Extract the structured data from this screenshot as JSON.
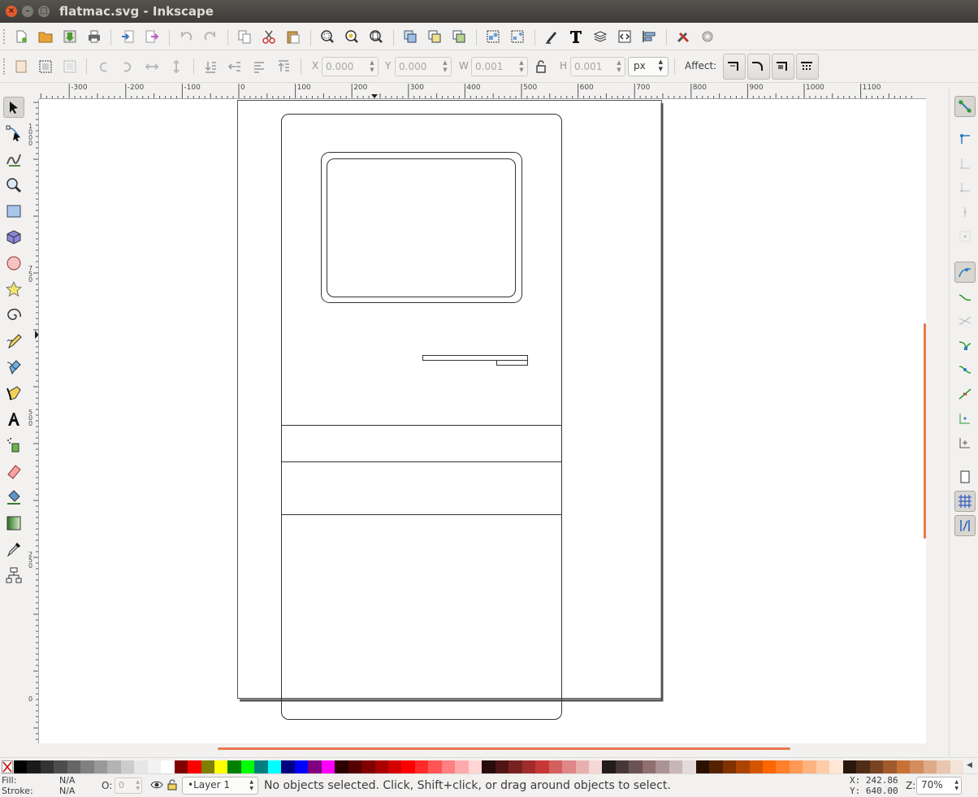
{
  "window": {
    "title": "flatmac.svg - Inkscape",
    "close_glyph": "×",
    "minimize_glyph": "–",
    "maximize_glyph": "□"
  },
  "controls": {
    "x_label": "X",
    "x_value": "0.000",
    "y_label": "Y",
    "y_value": "0.000",
    "w_label": "W",
    "w_value": "0.001",
    "h_label": "H",
    "h_value": "0.001",
    "unit": "px",
    "affect_label": "Affect:"
  },
  "rulers": {
    "horizontal": [
      "-300",
      "-200",
      "-100",
      "0",
      "100",
      "200",
      "300",
      "400",
      "500",
      "600",
      "700",
      "800",
      "900",
      "1000",
      "1100"
    ],
    "vertical": [
      "1000",
      "750",
      "500",
      "250",
      "0"
    ]
  },
  "status": {
    "fill_label": "Fill:",
    "fill_value": "N/A",
    "stroke_label": "Stroke:",
    "stroke_value": "N/A",
    "opacity_label": "O:",
    "opacity_value": "0",
    "layer": "•Layer 1",
    "message": "No objects selected. Click, Shift+click, or drag around objects to select.",
    "cursor_x": "X:  242.86",
    "cursor_y": "Y:  640.00",
    "zoom_label": "Z:",
    "zoom_value": "70%"
  },
  "palette": [
    "#000000",
    "#1a1a1a",
    "#333333",
    "#4d4d4d",
    "#666666",
    "#808080",
    "#999999",
    "#b3b3b3",
    "#cccccc",
    "#e6e6e6",
    "#f2f2f2",
    "#ffffff",
    "#800000",
    "#ff0000",
    "#808000",
    "#ffff00",
    "#008000",
    "#00ff00",
    "#008080",
    "#00ffff",
    "#000080",
    "#0000ff",
    "#800080",
    "#ff00ff",
    "#2b0000",
    "#550000",
    "#800000",
    "#aa0000",
    "#d40000",
    "#ff0000",
    "#ff2a2a",
    "#ff5555",
    "#ff8080",
    "#ffaaaa",
    "#ffd5d5",
    "#280b0b",
    "#501616",
    "#782121",
    "#a02c2c",
    "#c83737",
    "#d35f5f",
    "#de8787",
    "#e9afaf",
    "#f4d7d7",
    "#241c1c",
    "#483737",
    "#6c5353",
    "#916f6f",
    "#ac9393",
    "#c8b7b7",
    "#e3dbdb",
    "#2b1100",
    "#552200",
    "#803300",
    "#aa4400",
    "#d45500",
    "#ff6600",
    "#ff7f2a",
    "#ff9955",
    "#ffb380",
    "#ffccaa",
    "#ffe6d5",
    "#28170b",
    "#502d16",
    "#784421",
    "#a05a2c",
    "#c87137",
    "#d38d5f",
    "#deaa87",
    "#e9c6af",
    "#f4e3d7"
  ]
}
